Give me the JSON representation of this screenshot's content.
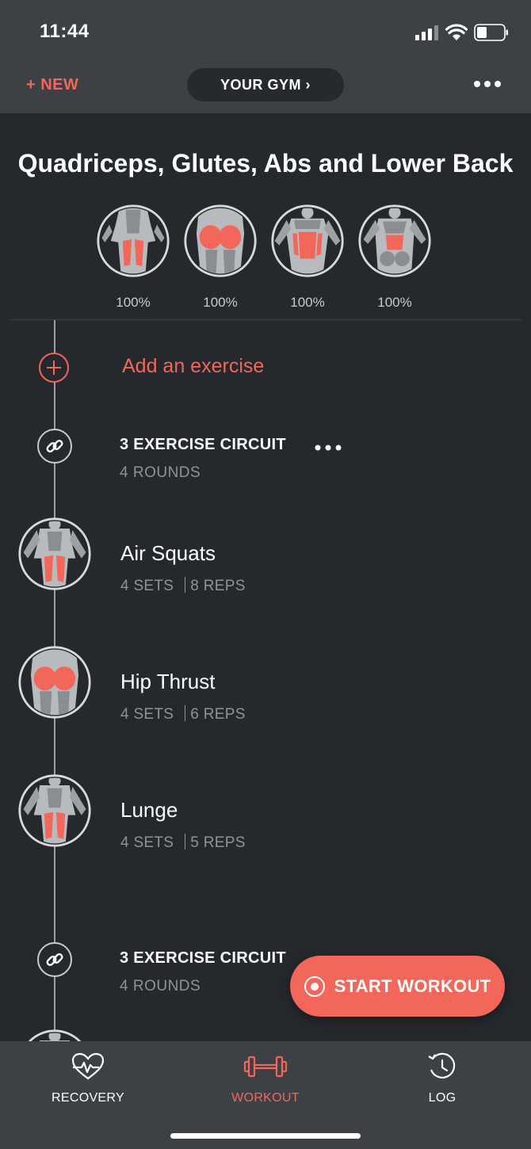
{
  "status_bar": {
    "time": "11:44"
  },
  "header": {
    "new_label": "+ NEW",
    "gym_label": "YOUR GYM ›"
  },
  "workout": {
    "title": "Quadriceps, Glutes, Abs and Lower Back",
    "muscle_groups": [
      {
        "icon": "quadriceps-icon",
        "percent": "100%"
      },
      {
        "icon": "glutes-icon",
        "percent": "100%"
      },
      {
        "icon": "abs-icon",
        "percent": "100%"
      },
      {
        "icon": "lower-back-icon",
        "percent": "100%"
      }
    ]
  },
  "add_exercise_label": "Add an exercise",
  "circuits": [
    {
      "title": "3 EXERCISE CIRCUIT",
      "rounds": "4 ROUNDS",
      "exercises": [
        {
          "name": "Air Squats",
          "sets": "4 SETS",
          "reps": "8 REPS",
          "icon": "quadriceps-icon"
        },
        {
          "name": "Hip Thrust",
          "sets": "4 SETS",
          "reps": "6 REPS",
          "icon": "glutes-icon"
        },
        {
          "name": "Lunge",
          "sets": "4 SETS",
          "reps": "5 REPS",
          "icon": "quadriceps-icon"
        }
      ]
    },
    {
      "title": "3 EXERCISE CIRCUIT",
      "rounds": "4 ROUNDS"
    }
  ],
  "start_workout_label": "START WORKOUT",
  "tabs": [
    {
      "label": "RECOVERY",
      "icon": "heart-pulse-icon",
      "active": false
    },
    {
      "label": "WORKOUT",
      "icon": "dumbbell-icon",
      "active": true
    },
    {
      "label": "LOG",
      "icon": "clock-history-icon",
      "active": false
    }
  ],
  "colors": {
    "accent": "#f2675a",
    "background": "#25282d",
    "header": "#3d4146",
    "muted_text": "#8f9398"
  }
}
